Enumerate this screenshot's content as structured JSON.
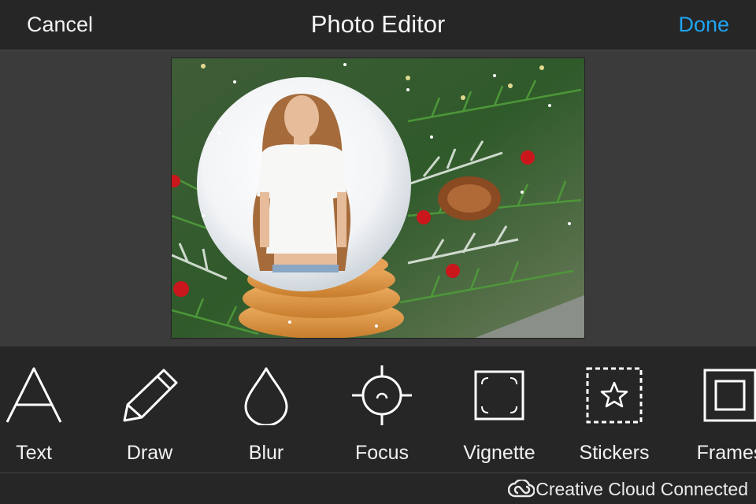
{
  "header": {
    "cancel_label": "Cancel",
    "title": "Photo Editor",
    "done_label": "Done",
    "accent_color": "#1ea4f0"
  },
  "tools": [
    {
      "label": "Text",
      "icon": "text-icon"
    },
    {
      "label": "Draw",
      "icon": "pencil-icon"
    },
    {
      "label": "Blur",
      "icon": "drop-icon"
    },
    {
      "label": "Focus",
      "icon": "crosshair-icon"
    },
    {
      "label": "Vignette",
      "icon": "vignette-icon"
    },
    {
      "label": "Stickers",
      "icon": "star-icon"
    },
    {
      "label": "Frames",
      "icon": "frame-icon"
    }
  ],
  "status": {
    "text": "Creative Cloud Connected",
    "icon": "creative-cloud-icon"
  }
}
